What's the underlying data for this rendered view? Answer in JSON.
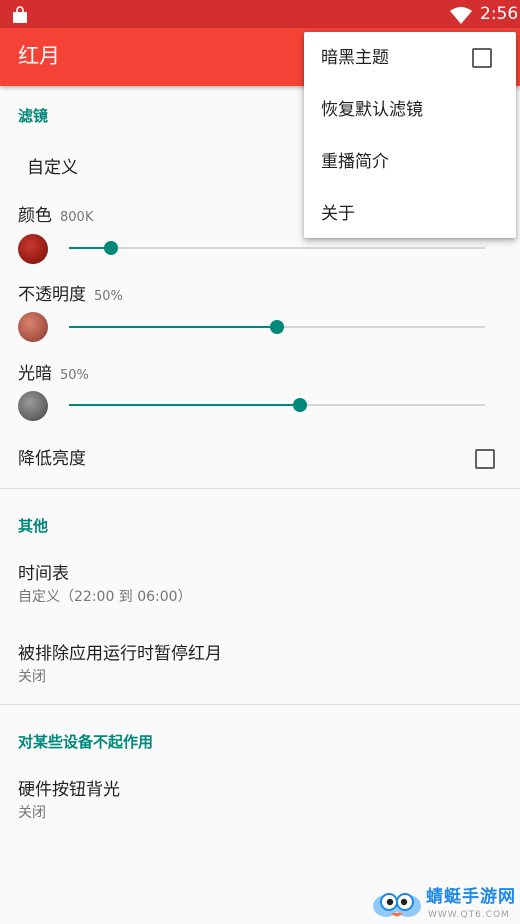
{
  "status_bar": {
    "time": "2:56",
    "icons": [
      "shopping-bag-icon",
      "wifi-icon",
      "battery-icon"
    ],
    "color": "#d32f2f"
  },
  "app_bar": {
    "title": "红月",
    "color": "#f44336"
  },
  "filter_section": {
    "header": "滤镜",
    "preset": "自定义",
    "color": {
      "label": "颜色",
      "value_text": "800K",
      "level_fraction": 0.1
    },
    "opacity": {
      "label": "不透明度",
      "value_text": "50%",
      "level_fraction": 0.5
    },
    "dim": {
      "label": "光暗",
      "value_text": "50%",
      "level_fraction": 0.555
    },
    "lower_brightness": {
      "label": "降低亮度",
      "checked": false
    }
  },
  "other_section": {
    "header": "其他",
    "schedule": {
      "title": "时间表",
      "summary": "自定义（22:00 到 06:00）"
    },
    "exclude_apps": {
      "title": "被排除应用运行时暂停红月",
      "summary": "关闭"
    }
  },
  "device_section": {
    "header": "对某些设备不起作用",
    "button_backlight": {
      "title": "硬件按钮背光",
      "summary": "关闭"
    }
  },
  "overflow_menu": {
    "items": [
      {
        "label": "暗黑主题",
        "has_checkbox": true,
        "checked": false
      },
      {
        "label": "恢复默认滤镜"
      },
      {
        "label": "重播简介"
      },
      {
        "label": "关于"
      }
    ]
  },
  "watermark": {
    "name": "蜻蜓手游网",
    "url": "WWW.QT6.COM"
  },
  "colors": {
    "accent": "#00897b",
    "primary": "#f44336",
    "primary_dark": "#d32f2f"
  }
}
